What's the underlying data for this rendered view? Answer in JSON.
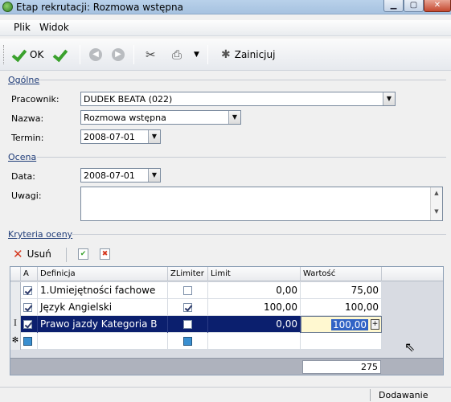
{
  "window": {
    "title": "Etap rekrutacji: Rozmowa wstępna"
  },
  "menu": {
    "file": "Plik",
    "view": "Widok"
  },
  "toolbar": {
    "ok": "OK",
    "init": "Zainicjuj"
  },
  "sections": {
    "general": "Ogólne",
    "rating": "Ocena",
    "criteria": "Kryteria oceny"
  },
  "general": {
    "employee_label": "Pracownik:",
    "employee_value": "DUDEK BEATA (022)",
    "name_label": "Nazwa:",
    "name_value": "Rozmowa wstępna",
    "date_label": "Termin:",
    "date_value": "2008-07-01"
  },
  "rating": {
    "date_label": "Data:",
    "date_value": "2008-07-01",
    "notes_label": "Uwagi:",
    "notes_value": ""
  },
  "criteria": {
    "delete_label": "Usuń",
    "columns": {
      "active": "A",
      "definition": "Definicja",
      "zlimiter": "ZLimiter",
      "limit": "Limit",
      "value": "Wartość"
    },
    "rows": [
      {
        "active": true,
        "definition": "1.Umiejętności fachowe",
        "zlimiter": false,
        "limit": "0,00",
        "value": "75,00"
      },
      {
        "active": true,
        "definition": "Język Angielski",
        "zlimiter": true,
        "limit": "100,00",
        "value": "100,00"
      },
      {
        "active": true,
        "definition": "Prawo jazdy Kategoria B",
        "zlimiter": false,
        "limit": "0,00",
        "value": "100,00"
      }
    ],
    "total": "275"
  },
  "status": {
    "mode": "Dodawanie"
  },
  "colors": {
    "selection": "#0b1f6e",
    "accent": "#1f3c78",
    "ok_green": "#3aa12d"
  }
}
